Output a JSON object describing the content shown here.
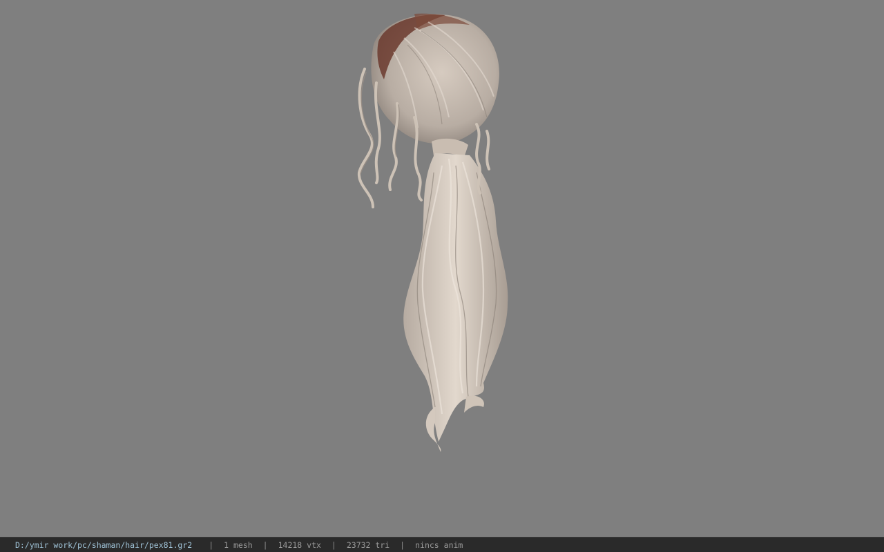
{
  "viewport": {
    "background_color": "#7f7f7f",
    "model": {
      "subject": "hair-model",
      "hair_color": "#d8cdc2",
      "root_color": "#6b3a2e"
    }
  },
  "status_bar": {
    "file_path": "D:/ymir work/pc/shaman/hair/pex81.gr2",
    "separator": "|",
    "mesh_count": "1 mesh",
    "vertex_count": "14218 vtx",
    "triangle_count": "23732 tri",
    "anim": "nincs anim"
  }
}
